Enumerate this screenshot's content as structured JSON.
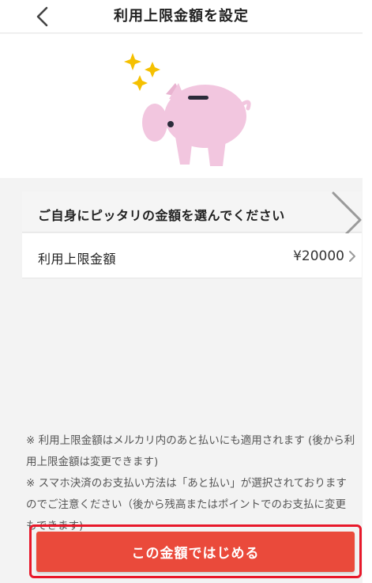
{
  "header": {
    "title": "利用上限金額を設定"
  },
  "section": {
    "title": "ご自身にピッタリの金額を選んでください"
  },
  "limit_row": {
    "label": "利用上限金額",
    "value": "¥20000"
  },
  "notes": [
    "※ 利用上限金額はメルカリ内のあと払いにも適用されます (後から利用上限金額は変更できます)",
    "※ スマホ決済のお支払い方法は「あと払い」が選択されておりますのでご注意ください（後から残高またはポイントでのお支払に変更もできます)"
  ],
  "cta": {
    "label": "この金額ではじめる"
  },
  "colors": {
    "cta_bg": "#ea4a3b",
    "highlight": "#e8182a",
    "sparkle": "#f5c000",
    "pig": "#f2c6df"
  },
  "icons": [
    "back-chevron-icon",
    "sparkle-icon",
    "piggy-bank-icon",
    "chevron-right-icon"
  ]
}
